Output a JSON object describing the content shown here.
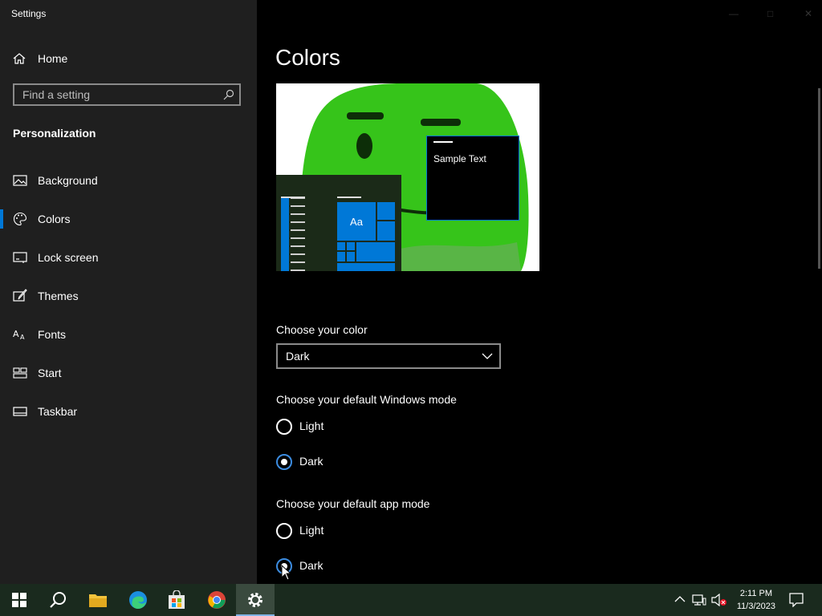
{
  "window": {
    "title": "Settings"
  },
  "sidebar": {
    "home_label": "Home",
    "search_placeholder": "Find a setting",
    "section_title": "Personalization",
    "items": [
      {
        "label": "Background",
        "icon": "image-icon"
      },
      {
        "label": "Colors",
        "icon": "palette-icon",
        "selected": true
      },
      {
        "label": "Lock screen",
        "icon": "lock-screen-icon"
      },
      {
        "label": "Themes",
        "icon": "brush-icon"
      },
      {
        "label": "Fonts",
        "icon": "font-icon"
      },
      {
        "label": "Start",
        "icon": "start-icon"
      },
      {
        "label": "Taskbar",
        "icon": "taskbar-icon"
      }
    ]
  },
  "main": {
    "title": "Colors",
    "preview": {
      "sample_text": "Sample Text",
      "tile_text": "Aa"
    },
    "choose_color": {
      "label": "Choose your color",
      "value": "Dark"
    },
    "windows_mode": {
      "label": "Choose your default Windows mode",
      "options": [
        "Light",
        "Dark"
      ],
      "selected": "Dark"
    },
    "app_mode": {
      "label": "Choose your default app mode",
      "options": [
        "Light",
        "Dark"
      ],
      "selected": "Dark"
    }
  },
  "taskbar": {
    "apps": [
      "start-icon",
      "search-icon",
      "file-explorer-icon",
      "edge-icon",
      "store-icon",
      "chrome-icon",
      "settings-icon"
    ],
    "active": "settings-icon",
    "time": "2:11 PM",
    "date": "11/3/2023"
  },
  "colors": {
    "accent": "#0078d7",
    "sidebar": "#1f1f1f",
    "background": "#000000",
    "taskbar": "#1a2a1e"
  }
}
